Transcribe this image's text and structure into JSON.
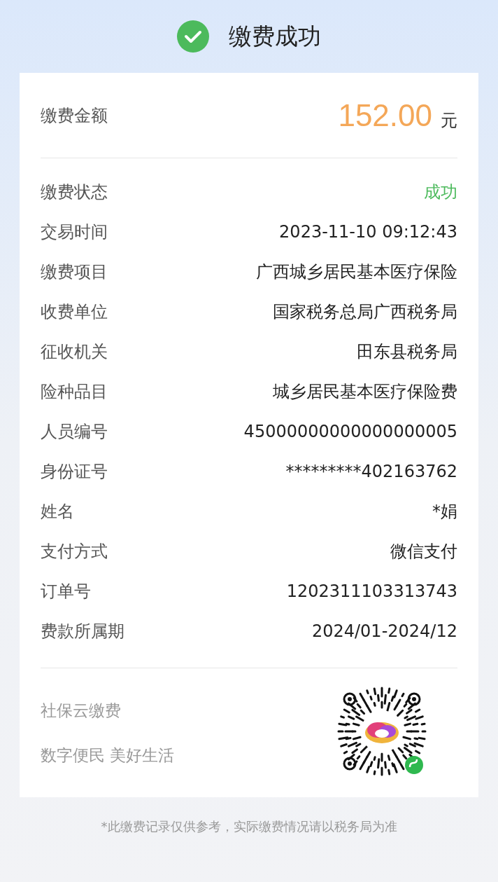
{
  "header": {
    "title": "缴费成功",
    "success": true
  },
  "amount": {
    "label": "缴费金额",
    "value": "152.00",
    "unit": "元"
  },
  "rows": [
    {
      "label": "缴费状态",
      "value": "成功",
      "kind": "status"
    },
    {
      "label": "交易时间",
      "value": "2023-11-10 09:12:43",
      "kind": "text"
    },
    {
      "label": "缴费项目",
      "value": "广西城乡居民基本医疗保险",
      "kind": "text"
    },
    {
      "label": "收费单位",
      "value": "国家税务总局广西税务局",
      "kind": "text"
    },
    {
      "label": "征收机关",
      "value": "田东县税务局",
      "kind": "text"
    },
    {
      "label": "险种品目",
      "value": "城乡居民基本医疗保险费",
      "kind": "text"
    },
    {
      "label": "人员编号",
      "value": "45000000000000000005",
      "kind": "text"
    },
    {
      "label": "身份证号",
      "value": "*********402163762",
      "kind": "text"
    },
    {
      "label": "姓名",
      "value": "*娟",
      "kind": "text"
    },
    {
      "label": "支付方式",
      "value": "微信支付",
      "kind": "text"
    },
    {
      "label": "订单号",
      "value": "1202311103313743",
      "kind": "text"
    },
    {
      "label": "费款所属期",
      "value": "2024/01-2024/12",
      "kind": "text"
    }
  ],
  "footer": {
    "brand": "社保云缴费",
    "slogan": "数字便民 美好生活"
  },
  "note": "*此缴费记录仅供参考，实际缴费情况请以税务局为准"
}
